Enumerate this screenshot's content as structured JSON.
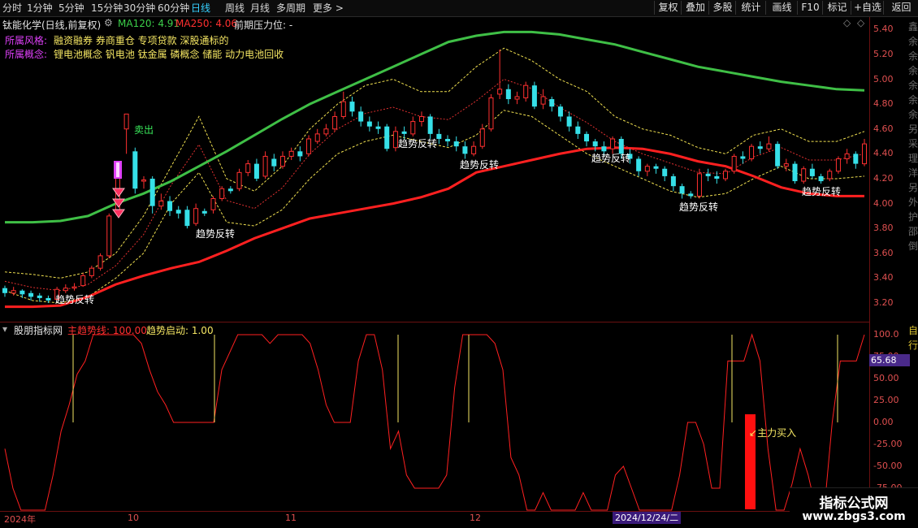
{
  "toolbar": {
    "periods": [
      "分时",
      "1分钟",
      "5分钟",
      "15分钟",
      "30分钟",
      "60分钟",
      "日线",
      "周线",
      "月线",
      "多周期",
      "更多 >"
    ],
    "active_index": 6,
    "right_buttons": [
      "复权",
      "叠加",
      "多股",
      "统计",
      "画线",
      "F10",
      "标记",
      "+自选",
      "返回"
    ]
  },
  "stock": {
    "title": "钛能化学(日线,前复权)",
    "ma120": "MA120: 4.91",
    "ma250": "MA250: 4.06",
    "pressure": "前期压力位: -",
    "style_label": "所属风格:",
    "style_value": "融资融券 券商重仓 专项贷款 深股通标的",
    "concept_label": "所属概念:",
    "concept_value": "锂电池概念 钒电池 钛金属 磷概念 储能 动力电池回收"
  },
  "price_axis": [
    "5.40",
    "5.20",
    "5.00",
    "4.80",
    "4.60",
    "4.40",
    "4.20",
    "4.00",
    "3.80",
    "3.60",
    "3.40",
    "3.20"
  ],
  "annotations": {
    "trend_reversal": "趋势反转",
    "sell": "卖出",
    "main_buy": "主力买入"
  },
  "indicator": {
    "name": "股朋指标网",
    "main_trend": "主趋势线: 100.00",
    "trend_start": "趋势启动: 1.00",
    "axis": [
      "100.0",
      "75.00",
      "50.00",
      "25.00",
      "0.00",
      "-25.00",
      "-50.00",
      "-75.00"
    ],
    "current_value": "65.68"
  },
  "x_axis": {
    "labels": [
      "2024年",
      "10",
      "11",
      "12"
    ],
    "cursor_date": "2024/12/24/二"
  },
  "edge_text": [
    "鑫",
    "余",
    "余",
    "余",
    "余",
    "余",
    "余",
    "另",
    "采",
    "理",
    "洋",
    "另",
    "外",
    "护",
    "邵",
    "倒"
  ],
  "edge_text_lower": [
    "自",
    "行"
  ],
  "watermark": {
    "title": "指标公式网",
    "url": "www.zbgs3.com"
  },
  "colors": {
    "up": "#ff3030",
    "down": "#36e0e8",
    "ma120": "#3fbf46",
    "ma250": "#ff2020",
    "band": "#f0e050",
    "indicator": "#ff2020",
    "signal": "#f5e663"
  },
  "chart_data": {
    "type": "candlestick",
    "y_range": [
      3.05,
      5.5
    ],
    "candles": [
      [
        3.32,
        3.28,
        3.34,
        3.25
      ],
      [
        3.28,
        3.3,
        3.33,
        3.26
      ],
      [
        3.3,
        3.27,
        3.31,
        3.24
      ],
      [
        3.28,
        3.25,
        3.3,
        3.22
      ],
      [
        3.26,
        3.24,
        3.28,
        3.21
      ],
      [
        3.24,
        3.22,
        3.26,
        3.2
      ],
      [
        3.23,
        3.31,
        3.33,
        3.22
      ],
      [
        3.3,
        3.32,
        3.35,
        3.28
      ],
      [
        3.32,
        3.33,
        3.36,
        3.3
      ],
      [
        3.34,
        3.42,
        3.44,
        3.33
      ],
      [
        3.42,
        3.48,
        3.5,
        3.4
      ],
      [
        3.48,
        3.58,
        3.6,
        3.46
      ],
      [
        3.58,
        3.9,
        3.92,
        3.56
      ],
      [
        3.92,
        4.25,
        4.28,
        3.9
      ],
      [
        4.6,
        4.72,
        4.72,
        4.4
      ],
      [
        4.42,
        4.12,
        4.45,
        4.08
      ],
      [
        4.18,
        4.19,
        4.22,
        4.12
      ],
      [
        4.2,
        3.98,
        4.22,
        3.92
      ],
      [
        3.98,
        4.02,
        4.08,
        3.95
      ],
      [
        4.02,
        3.94,
        4.06,
        3.9
      ],
      [
        3.95,
        3.92,
        3.98,
        3.88
      ],
      [
        3.95,
        3.82,
        3.98,
        3.8
      ],
      [
        3.84,
        3.96,
        4.0,
        3.82
      ],
      [
        3.94,
        3.92,
        3.96,
        3.9
      ],
      [
        3.95,
        4.04,
        4.06,
        3.92
      ],
      [
        4.04,
        4.12,
        4.14,
        4.02
      ],
      [
        4.12,
        4.1,
        4.14,
        4.08
      ],
      [
        4.12,
        4.25,
        4.28,
        4.1
      ],
      [
        4.25,
        4.32,
        4.35,
        4.22
      ],
      [
        4.32,
        4.2,
        4.36,
        4.18
      ],
      [
        4.22,
        4.38,
        4.42,
        4.2
      ],
      [
        4.36,
        4.3,
        4.4,
        4.26
      ],
      [
        4.3,
        4.38,
        4.42,
        4.28
      ],
      [
        4.38,
        4.42,
        4.45,
        4.35
      ],
      [
        4.42,
        4.38,
        4.46,
        4.34
      ],
      [
        4.4,
        4.52,
        4.55,
        4.38
      ],
      [
        4.5,
        4.56,
        4.6,
        4.48
      ],
      [
        4.56,
        4.6,
        4.64,
        4.54
      ],
      [
        4.6,
        4.7,
        4.74,
        4.58
      ],
      [
        4.7,
        4.82,
        4.9,
        4.68
      ],
      [
        4.82,
        4.74,
        4.86,
        4.7
      ],
      [
        4.74,
        4.66,
        4.78,
        4.62
      ],
      [
        4.66,
        4.62,
        4.7,
        4.58
      ],
      [
        4.62,
        4.6,
        4.66,
        4.56
      ],
      [
        4.62,
        4.44,
        4.64,
        4.42
      ],
      [
        4.45,
        4.58,
        4.62,
        4.42
      ],
      [
        4.58,
        4.56,
        4.62,
        4.52
      ],
      [
        4.56,
        4.66,
        4.7,
        4.54
      ],
      [
        4.66,
        4.7,
        4.74,
        4.62
      ],
      [
        4.7,
        4.56,
        4.72,
        4.52
      ],
      [
        4.56,
        4.52,
        4.6,
        4.48
      ],
      [
        4.52,
        4.5,
        4.55,
        4.46
      ],
      [
        4.5,
        4.46,
        4.54,
        4.42
      ],
      [
        4.46,
        4.4,
        4.5,
        4.36
      ],
      [
        4.4,
        4.46,
        4.5,
        4.38
      ],
      [
        4.46,
        4.6,
        4.64,
        4.44
      ],
      [
        4.6,
        4.85,
        4.88,
        4.58
      ],
      [
        4.88,
        4.92,
        5.24,
        4.84
      ],
      [
        4.92,
        4.84,
        4.96,
        4.8
      ],
      [
        4.84,
        4.86,
        4.9,
        4.8
      ],
      [
        4.85,
        4.95,
        4.98,
        4.82
      ],
      [
        4.95,
        4.78,
        4.98,
        4.76
      ],
      [
        4.8,
        4.86,
        4.92,
        4.76
      ],
      [
        4.84,
        4.78,
        4.86,
        4.74
      ],
      [
        4.78,
        4.7,
        4.8,
        4.66
      ],
      [
        4.7,
        4.62,
        4.74,
        4.58
      ],
      [
        4.62,
        4.56,
        4.66,
        4.52
      ],
      [
        4.56,
        4.5,
        4.58,
        4.46
      ],
      [
        4.5,
        4.46,
        4.52,
        4.42
      ],
      [
        4.46,
        4.42,
        4.5,
        4.38
      ],
      [
        4.44,
        4.52,
        4.54,
        4.4
      ],
      [
        4.52,
        4.4,
        4.54,
        4.36
      ],
      [
        4.4,
        4.36,
        4.44,
        4.32
      ],
      [
        4.36,
        4.26,
        4.38,
        4.22
      ],
      [
        4.26,
        4.3,
        4.32,
        4.22
      ],
      [
        4.3,
        4.28,
        4.32,
        4.24
      ],
      [
        4.28,
        4.22,
        4.3,
        4.18
      ],
      [
        4.22,
        4.14,
        4.24,
        4.1
      ],
      [
        4.14,
        4.08,
        4.16,
        4.04
      ],
      [
        4.08,
        4.06,
        4.1,
        4.04
      ],
      [
        4.06,
        4.24,
        4.28,
        4.04
      ],
      [
        4.24,
        4.22,
        4.28,
        4.18
      ],
      [
        4.22,
        4.2,
        4.26,
        4.16
      ],
      [
        4.2,
        4.26,
        4.28,
        4.18
      ],
      [
        4.26,
        4.38,
        4.4,
        4.24
      ],
      [
        4.38,
        4.36,
        4.42,
        4.32
      ],
      [
        4.36,
        4.46,
        4.48,
        4.34
      ],
      [
        4.46,
        4.44,
        4.5,
        4.4
      ],
      [
        4.44,
        4.48,
        4.54,
        4.42
      ],
      [
        4.48,
        4.3,
        4.5,
        4.28
      ],
      [
        4.3,
        4.32,
        4.36,
        4.26
      ],
      [
        4.32,
        4.18,
        4.34,
        4.16
      ],
      [
        4.18,
        4.28,
        4.3,
        4.16
      ],
      [
        4.28,
        4.22,
        4.32,
        4.2
      ],
      [
        4.22,
        4.18,
        4.24,
        4.16
      ],
      [
        4.2,
        4.26,
        4.28,
        4.18
      ],
      [
        4.26,
        4.36,
        4.38,
        4.24
      ],
      [
        4.36,
        4.4,
        4.44,
        4.32
      ],
      [
        4.4,
        4.32,
        4.42,
        4.28
      ],
      [
        4.32,
        4.48,
        4.52,
        4.3
      ]
    ],
    "ma120": [
      3.85,
      3.85,
      3.86,
      3.9,
      4.0,
      4.08,
      4.18,
      4.3,
      4.42,
      4.55,
      4.68,
      4.8,
      4.9,
      5.0,
      5.1,
      5.2,
      5.3,
      5.35,
      5.38,
      5.38,
      5.36,
      5.32,
      5.28,
      5.22,
      5.16,
      5.1,
      5.06,
      5.02,
      4.98,
      4.95,
      4.92,
      4.91
    ],
    "ma250": [
      3.17,
      3.17,
      3.18,
      3.25,
      3.35,
      3.42,
      3.48,
      3.53,
      3.62,
      3.72,
      3.8,
      3.88,
      3.92,
      3.96,
      4.0,
      4.05,
      4.12,
      4.25,
      4.3,
      4.35,
      4.4,
      4.44,
      4.45,
      4.44,
      4.4,
      4.34,
      4.3,
      4.22,
      4.13,
      4.08,
      4.06,
      4.06
    ],
    "band_upper": [
      3.45,
      3.43,
      3.4,
      3.45,
      3.6,
      3.9,
      4.3,
      4.7,
      4.2,
      4.1,
      4.3,
      4.6,
      4.8,
      4.95,
      5.0,
      4.9,
      4.9,
      5.1,
      5.25,
      5.15,
      5.0,
      4.9,
      4.7,
      4.6,
      4.55,
      4.45,
      4.4,
      4.55,
      4.6,
      4.5,
      4.5,
      4.58
    ],
    "band_lower": [
      3.3,
      3.22,
      3.2,
      3.25,
      3.4,
      3.6,
      4.0,
      4.25,
      3.85,
      3.82,
      3.95,
      4.2,
      4.4,
      4.5,
      4.55,
      4.5,
      4.45,
      4.55,
      4.75,
      4.7,
      4.55,
      4.4,
      4.3,
      4.2,
      4.1,
      4.05,
      4.08,
      4.2,
      4.3,
      4.2,
      4.2,
      4.22
    ],
    "reversal_markers": [
      [
        9,
        3.2
      ],
      [
        27,
        3.85
      ],
      [
        52,
        4.4
      ],
      [
        58,
        4.26
      ],
      [
        72,
        4.34
      ],
      [
        85,
        3.98
      ],
      [
        104,
        4.03
      ]
    ],
    "indicator": {
      "y_range": [
        -100,
        100
      ],
      "series": [
        -30,
        -75,
        -100,
        -100,
        -100,
        -100,
        -60,
        -10,
        20,
        55,
        70,
        100,
        100,
        100,
        100,
        100,
        100,
        90,
        60,
        35,
        20,
        0,
        0,
        0,
        0,
        0,
        0,
        60,
        80,
        100,
        100,
        100,
        100,
        90,
        100,
        100,
        100,
        100,
        90,
        60,
        20,
        0,
        0,
        0,
        70,
        100,
        100,
        60,
        -30,
        -10,
        -60,
        -75,
        -75,
        -75,
        -75,
        -60,
        40,
        100,
        100,
        100,
        100,
        90,
        60,
        -40,
        -60,
        -100,
        -100,
        -80,
        -100,
        -100,
        -100,
        -100,
        -80,
        -100,
        -100,
        -100,
        -60,
        -50,
        -75,
        -100,
        -100,
        -100,
        -100,
        -100,
        -60,
        0,
        0,
        -25,
        -75,
        -75,
        70,
        70,
        70,
        100,
        70,
        -30,
        -100,
        -100,
        -70,
        -30,
        -60,
        -100,
        -100,
        0,
        70,
        70,
        70,
        100
      ]
    }
  }
}
